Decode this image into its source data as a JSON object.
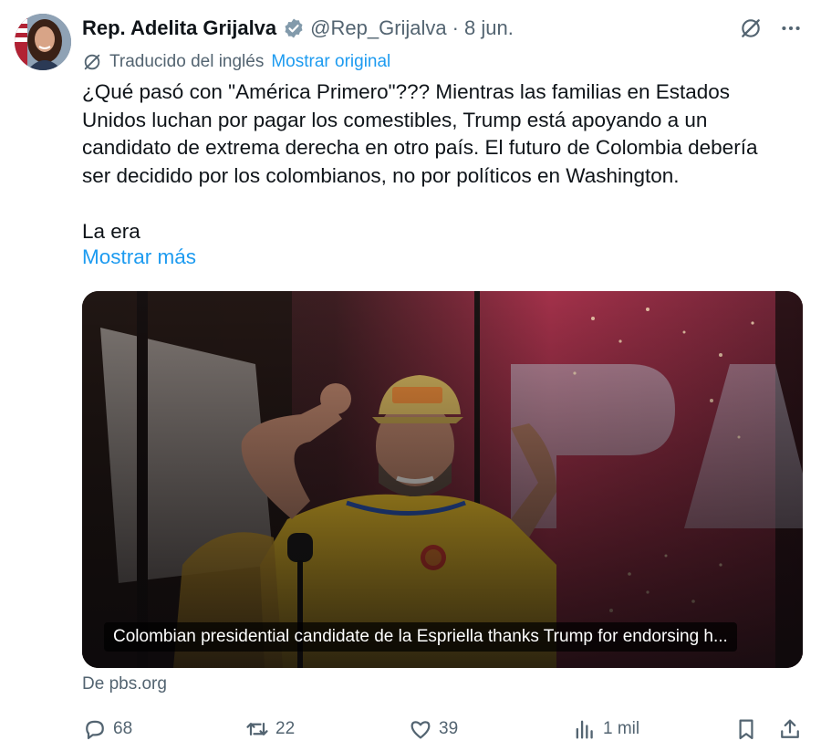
{
  "author": {
    "display_name": "Rep. Adelita Grijalva",
    "handle": "@Rep_Grijalva",
    "separator": "·",
    "time": "8 jun."
  },
  "translation": {
    "label": "Traducido del inglés",
    "link": "Mostrar original"
  },
  "tweet": {
    "lines": [
      "¿Qué pasó con \"América Primero\"??? Mientras las familias en Estados",
      "Unidos luchan por pagar los comestibles, Trump está apoyando a un",
      "candidato de extrema derecha en otro país. El futuro de Colombia debería",
      "ser decidido por los colombianos, no por políticos en Washington."
    ],
    "last_line": "La era",
    "show_more": "Mostrar más"
  },
  "media": {
    "caption": "Colombian presidential candidate de la Espriella thanks Trump for endorsing h..."
  },
  "source": "De pbs.org",
  "actions": {
    "replies": "68",
    "reposts": "22",
    "likes": "39",
    "views": "1 mil"
  },
  "colors": {
    "accent": "#1d9bf0",
    "secondary_text": "#536471",
    "primary_text": "#0f1419",
    "verified": "#829aab"
  },
  "icons": [
    "verified-badge-icon",
    "grok-icon",
    "more-icon",
    "translate-icon",
    "reply-icon",
    "repost-icon",
    "like-icon",
    "views-icon",
    "bookmark-icon",
    "share-icon"
  ]
}
